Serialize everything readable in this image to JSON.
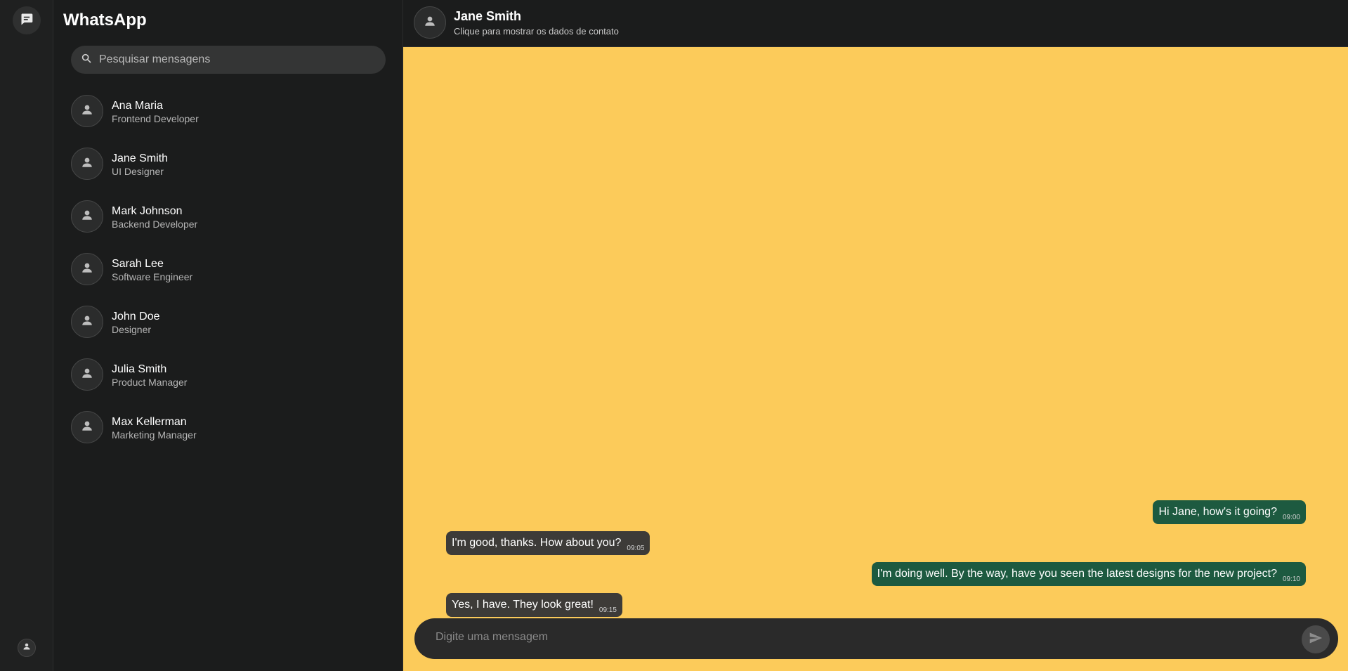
{
  "app": {
    "title": "WhatsApp"
  },
  "rail": {
    "top_icon": "chat-icon",
    "bottom_icon": "person-icon"
  },
  "search": {
    "placeholder": "Pesquisar mensagens",
    "icon": "search-icon"
  },
  "contacts": [
    {
      "name": "Ana Maria",
      "role": "Frontend Developer"
    },
    {
      "name": "Jane Smith",
      "role": "UI Designer"
    },
    {
      "name": "Mark Johnson",
      "role": "Backend Developer"
    },
    {
      "name": "Sarah Lee",
      "role": "Software Engineer"
    },
    {
      "name": "John Doe",
      "role": "Designer"
    },
    {
      "name": "Julia Smith",
      "role": "Product Manager"
    },
    {
      "name": "Max Kellerman",
      "role": "Marketing Manager"
    }
  ],
  "chat": {
    "name": "Jane Smith",
    "subtitle": "Clique para mostrar os dados de contato",
    "background_color": "#fccb5a",
    "messages": [
      {
        "direction": "outgoing",
        "text": "Hi Jane, how's it going?",
        "time": "09:00"
      },
      {
        "direction": "incoming",
        "text": "I'm good, thanks. How about you?",
        "time": "09:05"
      },
      {
        "direction": "outgoing",
        "text": "I'm doing well. By the way, have you seen the latest designs for the new project?",
        "time": "09:10"
      },
      {
        "direction": "incoming",
        "text": "Yes, I have. They look great!",
        "time": "09:15"
      }
    ],
    "composer_placeholder": "Digite uma mensagem",
    "send_icon": "send-icon"
  },
  "colors": {
    "outgoing_bubble": "#1d5a40",
    "incoming_bubble": "#3d3b38",
    "sidebar_bg": "#1b1c1c"
  }
}
